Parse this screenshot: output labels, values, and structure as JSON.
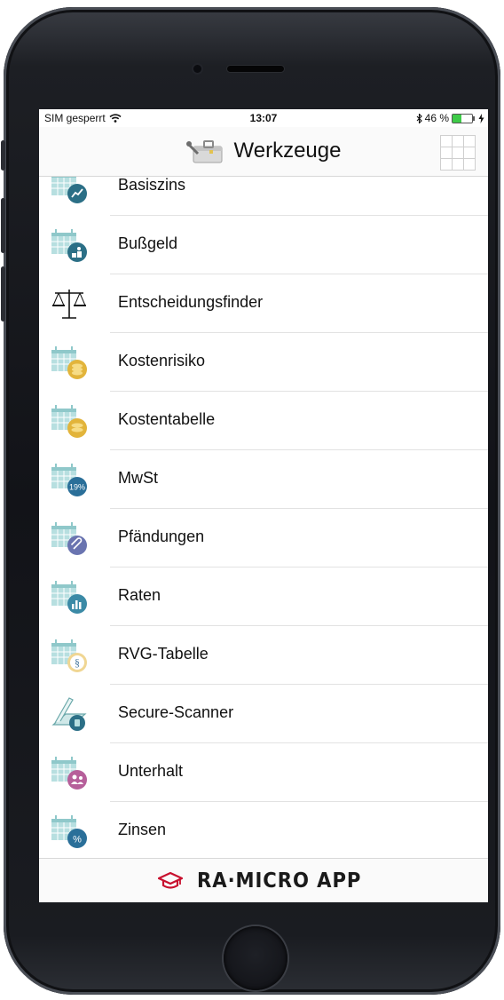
{
  "status_bar": {
    "carrier": "SIM gesperrt",
    "time": "13:07",
    "battery_text": "46 %",
    "battery_level": 0.46
  },
  "nav": {
    "title": "Werkzeuge"
  },
  "tools": [
    {
      "label": "Basiszins",
      "icon": "calendar-chart-icon",
      "badge_color": "#2b6f86"
    },
    {
      "label": "Bußgeld",
      "icon": "calendar-coins-icon",
      "badge_color": "#2b6f86"
    },
    {
      "label": "Entscheidungsfinder",
      "icon": "scales-icon",
      "badge_color": "#111111"
    },
    {
      "label": "Kostenrisiko",
      "icon": "calendar-coins-icon",
      "badge_color": "#e2b43b"
    },
    {
      "label": "Kostentabelle",
      "icon": "calendar-coins-icon",
      "badge_color": "#e2b43b"
    },
    {
      "label": "MwSt",
      "icon": "calendar-percent-icon",
      "badge_color": "#2a6f99"
    },
    {
      "label": "Pfändungen",
      "icon": "calendar-clip-icon",
      "badge_color": "#6a74b0"
    },
    {
      "label": "Raten",
      "icon": "calendar-bars-icon",
      "badge_color": "#3b8aa6"
    },
    {
      "label": "RVG-Tabelle",
      "icon": "calendar-paragraph-icon",
      "badge_color": "#f0d693"
    },
    {
      "label": "Secure-Scanner",
      "icon": "scanner-icon",
      "badge_color": "#2b6f86"
    },
    {
      "label": "Unterhalt",
      "icon": "calendar-people-icon",
      "badge_color": "#b65f9a"
    },
    {
      "label": "Zinsen",
      "icon": "calendar-percent-icon",
      "badge_color": "#2a6f99"
    }
  ],
  "badge_texts": {
    "mwst": "19%",
    "zinsen": "%",
    "rvg": "§"
  },
  "footer": {
    "brand": "RA·MICRO APP",
    "brand_color": "#c8102e"
  },
  "colors": {
    "calendar": "#b7dfe0",
    "calendar_dark": "#8fc8ca"
  }
}
